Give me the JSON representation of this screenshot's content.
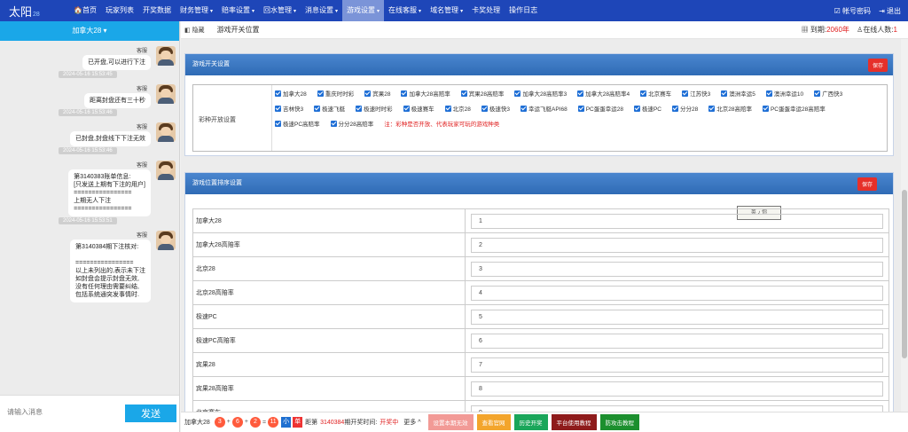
{
  "app": {
    "logo": "太阳",
    "logo_sub": "28"
  },
  "nav": [
    {
      "label": "🏠首页",
      "caret": false,
      "active": false
    },
    {
      "label": "玩家列表",
      "caret": false,
      "active": false
    },
    {
      "label": "开奖数据",
      "caret": false,
      "active": false
    },
    {
      "label": "财务管理",
      "caret": true,
      "active": false
    },
    {
      "label": "赔率设置",
      "caret": true,
      "active": false
    },
    {
      "label": "回水管理",
      "caret": true,
      "active": false
    },
    {
      "label": "消息设置",
      "caret": true,
      "active": false
    },
    {
      "label": "游戏设置",
      "caret": true,
      "active": true
    },
    {
      "label": "在线客服",
      "caret": true,
      "active": false
    },
    {
      "label": "域名管理",
      "caret": true,
      "active": false
    },
    {
      "label": "卡奖处理",
      "caret": false,
      "active": false
    },
    {
      "label": "操作日志",
      "caret": false,
      "active": false
    }
  ],
  "topright": {
    "password": "帐号密码",
    "logout": "退出"
  },
  "left": {
    "game_select": "加拿大28 ▾",
    "messages": [
      {
        "sender": "客服",
        "text": "已开盘,可以进行下注",
        "time": "2024-05-16 15:53:45"
      },
      {
        "sender": "客服",
        "text": "距离封盘还有三十秒",
        "time": "2024-05-16 15:53:46"
      },
      {
        "sender": "客服",
        "text": "已封盘,封盘线下下注无效",
        "time": "2024-05-16 15:53:46"
      },
      {
        "sender": "客服",
        "text": "第3140383账单信息:\n[只发送上期有下注的用户]\n================\n上期无人下注\n================",
        "time": "2024-05-16 15:53:51"
      },
      {
        "sender": "客服",
        "text": "第3140384期下注核对:\n\n================\n以上未列出的,表示未下注\n如封盘会提示封盘无效,\n没有任何理由需要纠结,\n包括系统通突发事情时.",
        "time": ""
      }
    ],
    "input_placeholder": "请输入消息",
    "send_label": "发送"
  },
  "breadcrumb": {
    "hide": "隐藏",
    "title": "游戏开关位置",
    "expire_label": "到期:",
    "expire_value": "2060年",
    "online_label": "在线人数:",
    "online_value": "1"
  },
  "switch_panel": {
    "title": "游戏开关设置",
    "save": "保存",
    "row_label": "彩种开放设置",
    "lotteries": [
      "加拿大28",
      "重庆时时彩",
      "宾果28",
      "加拿大28高赔率",
      "宾果28高赔率",
      "加拿大28高赔率3",
      "加拿大28高赔率4",
      "北京赛车",
      "江苏快3",
      "澳洲幸运5",
      "澳洲幸运10",
      "广西快3",
      "吉林快3",
      "极速飞艇",
      "极速时时彩",
      "极速赛车",
      "北京28",
      "极速快3",
      "幸运飞艇API68",
      "PC蛋蛋幸运28",
      "极速PC",
      "分分28",
      "北京28高赔率",
      "PC蛋蛋幸运28高赔率",
      "极速PC高赔率",
      "分分28高赔率"
    ],
    "note": "注：彩种是否开放、代表玩家可玩的游戏种类"
  },
  "order_panel": {
    "title": "游戏位置排序设置",
    "save": "保存",
    "stamp": "英 ♪ 你",
    "rows": [
      {
        "name": "加拿大28",
        "value": "1"
      },
      {
        "name": "加拿大28高赔率",
        "value": "2"
      },
      {
        "name": "北京28",
        "value": "3"
      },
      {
        "name": "北京28高赔率",
        "value": "4"
      },
      {
        "name": "极速PC",
        "value": "5"
      },
      {
        "name": "极速PC高赔率",
        "value": "6"
      },
      {
        "name": "宾果28",
        "value": "7"
      },
      {
        "name": "宾果28高赔率",
        "value": "8"
      },
      {
        "name": "北京赛车",
        "value": "9"
      }
    ]
  },
  "bottom": {
    "game": "加拿大28",
    "nums": [
      "3",
      "6",
      "2"
    ],
    "sum": "11",
    "size": "小",
    "parity": "单",
    "distance": "距第",
    "period": "3140384",
    "open_label": "期开奖时间:",
    "open_status": "开奖中",
    "more": "更多 ^",
    "buttons": [
      {
        "label": "设置本期无效",
        "color": "#f29a96"
      },
      {
        "label": "查看官网",
        "color": "#f3a52c"
      },
      {
        "label": "历史开奖",
        "color": "#1aa65a"
      },
      {
        "label": "平台使用教程",
        "color": "#8e1b1b"
      },
      {
        "label": "防攻击教程",
        "color": "#1c8f2e"
      }
    ]
  }
}
